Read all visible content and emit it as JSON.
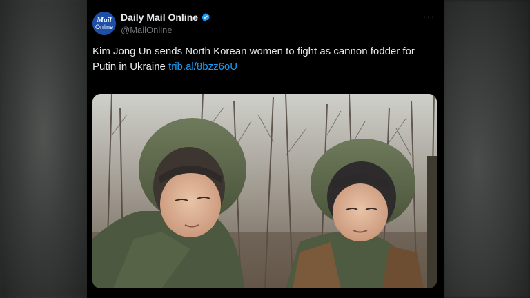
{
  "account": {
    "display_name": "Daily Mail Online",
    "handle": "@MailOnline",
    "avatar_line1": "Mail",
    "avatar_line2": "Online"
  },
  "tweet": {
    "text": "Kim Jong Un sends North Korean women to fight as cannon fodder for Putin in Ukraine ",
    "link": "trib.al/8bzz6oU"
  },
  "icons": {
    "verified": "verified-badge-icon",
    "more": "more-options-icon"
  },
  "colors": {
    "background": "#000000",
    "text": "#e7e9ea",
    "secondary": "#71767b",
    "link": "#1d9bf0",
    "verified": "#1d9bf0",
    "avatar": "#1d4ea8"
  }
}
